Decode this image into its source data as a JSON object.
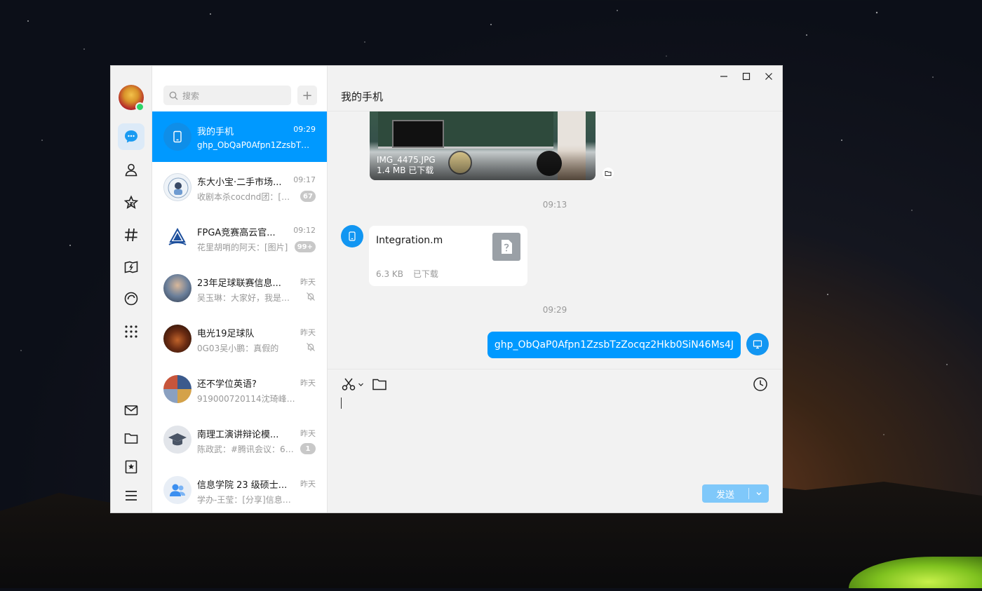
{
  "search": {
    "placeholder": "搜索"
  },
  "add_button": {
    "label": "+"
  },
  "rail": {
    "items": [
      "avatar",
      "chat-icon",
      "contacts-icon",
      "favorites-icon",
      "channel-icon",
      "moments-icon",
      "mini-program-icon",
      "apps-icon",
      "mail-icon",
      "folder-icon",
      "collection-icon",
      "menu-icon"
    ],
    "active": "chat-icon"
  },
  "conversations": [
    {
      "name": "我的手机",
      "time": "09:29",
      "preview": "ghp_ObQaP0Afpn1ZzsbTz...",
      "badge": "",
      "muted": false,
      "selected": true
    },
    {
      "name": "东大小宝·二手市场...",
      "time": "09:17",
      "preview": "收剧本杀cocdnd团：[动...",
      "badge": "67",
      "muted": false
    },
    {
      "name": "FPGA竞赛高云官...",
      "time": "09:12",
      "preview": "花里胡哨的阿天：[图片]",
      "badge": "99+",
      "muted": false
    },
    {
      "name": "23年足球联赛信息...",
      "time": "昨天",
      "preview": "吴玉琳：大家好，我是吴...",
      "badge": "",
      "muted": true
    },
    {
      "name": "电光19足球队",
      "time": "昨天",
      "preview": "0G03吴小鹏：真假的",
      "badge": "",
      "muted": true
    },
    {
      "name": "还不学位英语?",
      "time": "昨天",
      "preview": "919000720114沈琦峰：[辛...",
      "badge": "",
      "muted": false
    },
    {
      "name": "南理工演讲辩论模...",
      "time": "昨天",
      "preview": "陈政武：#腾讯会议：61...",
      "badge": "1",
      "muted": false
    },
    {
      "name": "信息学院 23 级硕士...",
      "time": "昨天",
      "preview": "学办-王莹：[分享]信息速递 |...",
      "badge": "",
      "muted": false
    }
  ],
  "chat": {
    "title": "我的手机",
    "image_message": {
      "filename": "IMG_4475.JPG",
      "status": "1.4 MB 已下载"
    },
    "time_divider_1": "09:13",
    "file_message": {
      "filename": "Integration.m",
      "size": "6.3 KB",
      "status": "已下载"
    },
    "time_divider_2": "09:29",
    "text_message": "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"
  },
  "input": {
    "send_label": "发送"
  },
  "colors": {
    "accent": "#0099ff",
    "send_disabled": "#7fc8fa",
    "online": "#2bd46a"
  }
}
